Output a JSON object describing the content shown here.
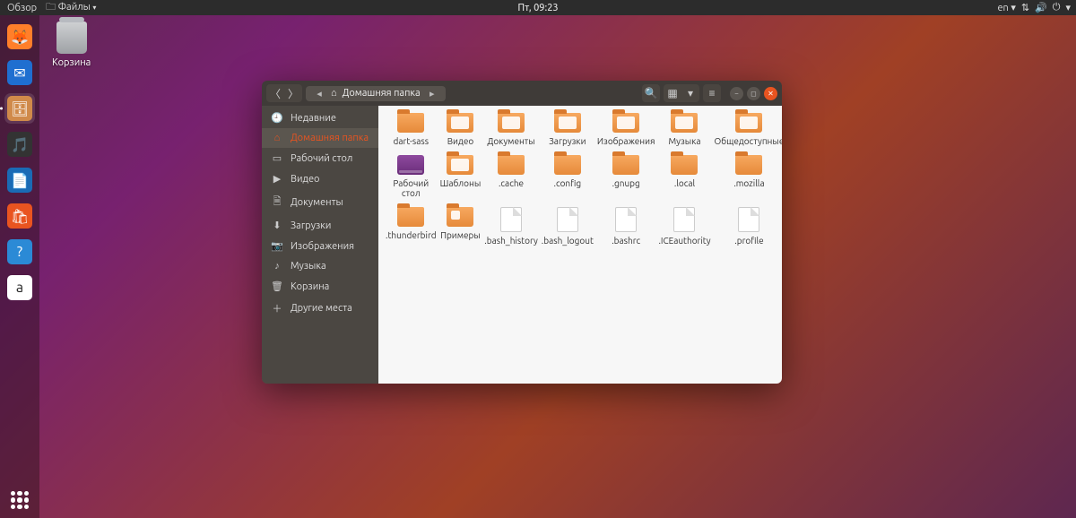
{
  "topbar": {
    "activities": "Обзор",
    "app_menu": "Файлы",
    "clock": "Пт, 09:23",
    "lang": "en"
  },
  "desktop": {
    "trash_label": "Корзина"
  },
  "dock": [
    {
      "name": "firefox",
      "color": "#ff7f2a",
      "glyph": "🦊"
    },
    {
      "name": "thunderbird",
      "color": "#1f6fd0",
      "glyph": "✉"
    },
    {
      "name": "files",
      "color": "#d08a4a",
      "glyph": "🗄",
      "active": true
    },
    {
      "name": "rhythmbox",
      "color": "#333",
      "glyph": "🎵"
    },
    {
      "name": "writer",
      "color": "#1a6bb5",
      "glyph": "📄"
    },
    {
      "name": "software",
      "color": "#e95420",
      "glyph": "🛍"
    },
    {
      "name": "help",
      "color": "#2b8ad6",
      "glyph": "?"
    },
    {
      "name": "amazon",
      "color": "#fff",
      "glyph": "a"
    }
  ],
  "window": {
    "breadcrumb": "Домашняя папка",
    "sidebar": [
      {
        "icon": "🕘",
        "label": "Недавние"
      },
      {
        "icon": "⌂",
        "label": "Домашняя папка",
        "selected": true
      },
      {
        "icon": "▭",
        "label": "Рабочий стол"
      },
      {
        "icon": "▶",
        "label": "Видео"
      },
      {
        "icon": "🗎",
        "label": "Документы"
      },
      {
        "icon": "⬇",
        "label": "Загрузки"
      },
      {
        "icon": "📷",
        "label": "Изображения"
      },
      {
        "icon": "♪",
        "label": "Музыка"
      },
      {
        "icon": "🗑",
        "label": "Корзина"
      },
      {
        "icon": "＋",
        "label": "Другие места"
      }
    ],
    "files": [
      {
        "type": "folder",
        "label": "dart-sass"
      },
      {
        "type": "folder",
        "label": "Видео",
        "emblem": true
      },
      {
        "type": "folder",
        "label": "Документы",
        "emblem": true
      },
      {
        "type": "folder",
        "label": "Загрузки",
        "emblem": true
      },
      {
        "type": "folder",
        "label": "Изображения",
        "emblem": true
      },
      {
        "type": "folder",
        "label": "Музыка",
        "emblem": true
      },
      {
        "type": "folder",
        "label": "Общедоступные",
        "emblem": true
      },
      {
        "type": "desktop",
        "label": "Рабочий стол"
      },
      {
        "type": "folder",
        "label": "Шаблоны",
        "emblem": true
      },
      {
        "type": "folder",
        "label": ".cache"
      },
      {
        "type": "folder",
        "label": ".config"
      },
      {
        "type": "folder",
        "label": ".gnupg"
      },
      {
        "type": "folder",
        "label": ".local"
      },
      {
        "type": "folder",
        "label": ".mozilla"
      },
      {
        "type": "folder",
        "label": ".thunderbird"
      },
      {
        "type": "link",
        "label": "Примеры"
      },
      {
        "type": "file",
        "label": ".bash_history"
      },
      {
        "type": "file",
        "label": ".bash_logout"
      },
      {
        "type": "file",
        "label": ".bashrc"
      },
      {
        "type": "file",
        "label": ".ICEauthority"
      },
      {
        "type": "file",
        "label": ".profile"
      }
    ]
  }
}
